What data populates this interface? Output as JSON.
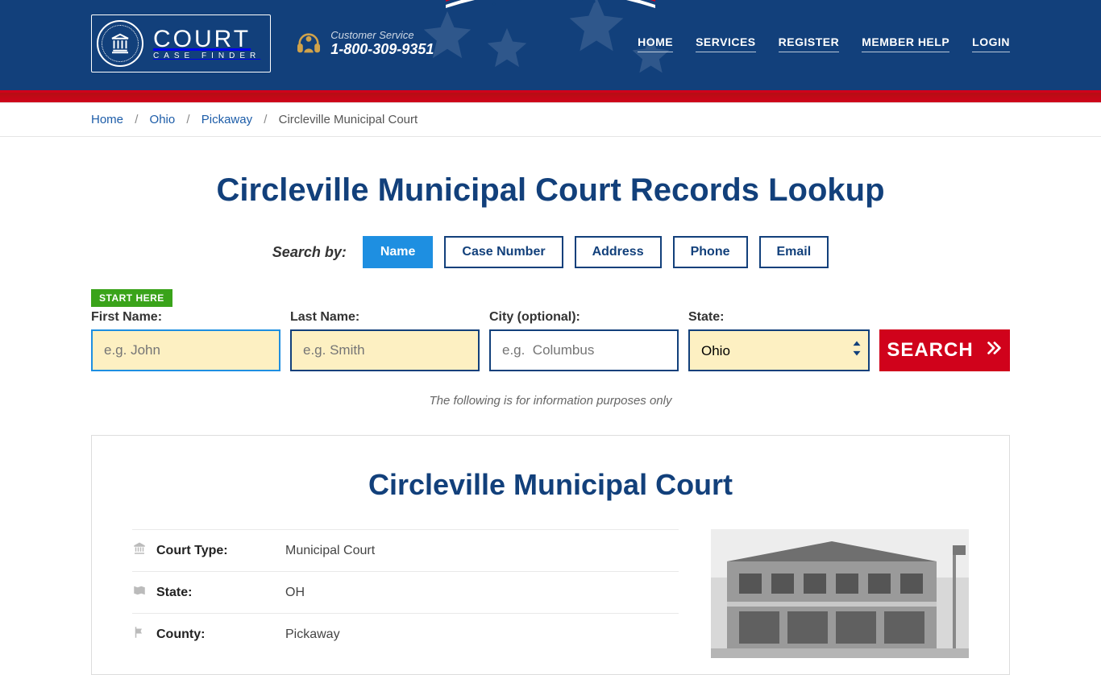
{
  "header": {
    "logo_line1": "COURT",
    "logo_line2": "CASE FINDER",
    "customer_service_label": "Customer Service",
    "customer_service_phone": "1-800-309-9351",
    "nav": {
      "home": "HOME",
      "services": "SERVICES",
      "register": "REGISTER",
      "member_help": "MEMBER HELP",
      "login": "LOGIN"
    }
  },
  "breadcrumb": {
    "home": "Home",
    "state": "Ohio",
    "county": "Pickaway",
    "current": "Circleville Municipal Court"
  },
  "page_title": "Circleville Municipal Court Records Lookup",
  "search_by": {
    "label": "Search by:",
    "tabs": {
      "name": "Name",
      "case_number": "Case Number",
      "address": "Address",
      "phone": "Phone",
      "email": "Email"
    }
  },
  "start_here": "START HERE",
  "form": {
    "first_name_label": "First Name:",
    "first_name_placeholder": "e.g. John",
    "last_name_label": "Last Name:",
    "last_name_placeholder": "e.g. Smith",
    "city_label": "City (optional):",
    "city_placeholder": "e.g.  Columbus",
    "state_label": "State:",
    "state_value": "Ohio",
    "submit": "SEARCH"
  },
  "disclaimer": "The following is for information purposes only",
  "card": {
    "title": "Circleville Municipal Court",
    "rows": {
      "court_type_label": "Court Type:",
      "court_type_value": "Municipal Court",
      "state_label": "State:",
      "state_value": "OH",
      "county_label": "County:",
      "county_value": "Pickaway"
    }
  }
}
